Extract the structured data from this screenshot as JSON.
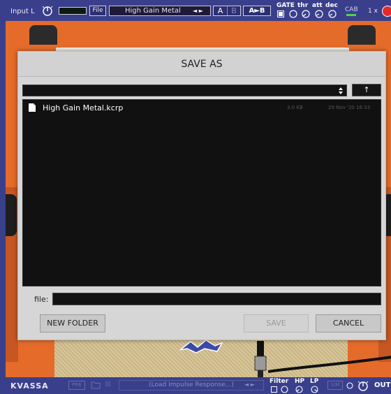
{
  "topbar": {
    "input_label": "Input L",
    "file_label": "File",
    "preset_name": "High Gain Metal",
    "preset_arrows": "◄ ►",
    "ab_a": "A",
    "ab_b": "B",
    "copy_ab": "A►B",
    "gate_label": "GATE",
    "thr_label": "thr",
    "att_label": "att",
    "dec_label": "dec",
    "cab_label": "CAB",
    "multiplier": "1 x"
  },
  "dialog": {
    "title": "SAVE AS",
    "path_value": "",
    "up_icon": "↑",
    "files": [
      {
        "name": "High Gain Metal.kcrp",
        "size": "3.0 KB",
        "date": "29 Nov '20 16:33"
      }
    ],
    "file_label": "file:",
    "file_value": "",
    "new_folder_label": "NEW FOLDER",
    "save_label": "SAVE",
    "cancel_label": "CANCEL"
  },
  "bottombar": {
    "logo": "KVASSA",
    "ir_bypass": "PRE",
    "ir_close": "☒",
    "ir_name": "(Load Impulse Response...)",
    "ir_arrows": "◄ ►",
    "filter_label": "Filter",
    "hp_label": "HP",
    "lp_label": "LP",
    "sim_label": "SIM",
    "out_label": "OUT"
  },
  "colors": {
    "brand_blue": "#3a3f8c",
    "amp_orange": "#e56b2b",
    "power_red": "#e62a2a",
    "cab_led": "#4cd44c"
  }
}
